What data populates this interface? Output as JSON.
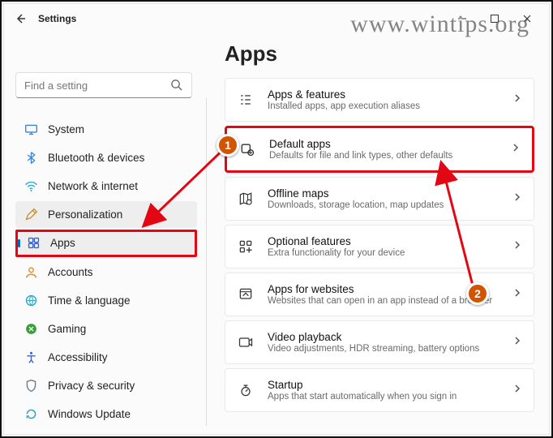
{
  "watermark": "www.wintips.org",
  "header": {
    "title": "Settings"
  },
  "search": {
    "placeholder": "Find a setting"
  },
  "sidebar": {
    "items": [
      {
        "label": "System"
      },
      {
        "label": "Bluetooth & devices"
      },
      {
        "label": "Network & internet"
      },
      {
        "label": "Personalization"
      },
      {
        "label": "Apps"
      },
      {
        "label": "Accounts"
      },
      {
        "label": "Time & language"
      },
      {
        "label": "Gaming"
      },
      {
        "label": "Accessibility"
      },
      {
        "label": "Privacy & security"
      },
      {
        "label": "Windows Update"
      }
    ]
  },
  "page": {
    "title": "Apps"
  },
  "cards": [
    {
      "title": "Apps & features",
      "sub": "Installed apps, app execution aliases"
    },
    {
      "title": "Default apps",
      "sub": "Defaults for file and link types, other defaults"
    },
    {
      "title": "Offline maps",
      "sub": "Downloads, storage location, map updates"
    },
    {
      "title": "Optional features",
      "sub": "Extra functionality for your device"
    },
    {
      "title": "Apps for websites",
      "sub": "Websites that can open in an app instead of a browser"
    },
    {
      "title": "Video playback",
      "sub": "Video adjustments, HDR streaming, battery options"
    },
    {
      "title": "Startup",
      "sub": "Apps that start automatically when you sign in"
    }
  ],
  "callouts": {
    "one": "1",
    "two": "2"
  }
}
